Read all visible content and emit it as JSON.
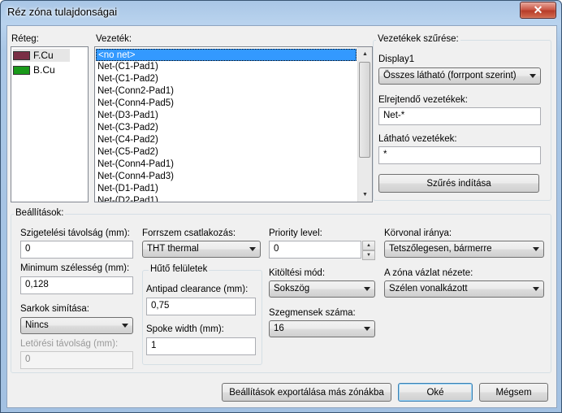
{
  "window": {
    "title": "Réz zóna tulajdonságai",
    "close_glyph": "✕"
  },
  "layers": {
    "label": "Réteg:",
    "items": [
      {
        "name": "F.Cu",
        "color": "#7a2e45"
      },
      {
        "name": "B.Cu",
        "color": "#1a9a1a"
      }
    ]
  },
  "nets": {
    "label": "Vezeték:",
    "items": [
      "<no net>",
      "Net-(C1-Pad1)",
      "Net-(C1-Pad2)",
      "Net-(Conn2-Pad1)",
      "Net-(Conn4-Pad5)",
      "Net-(D3-Pad1)",
      "Net-(C3-Pad2)",
      "Net-(C4-Pad2)",
      "Net-(C5-Pad2)",
      "Net-(Conn4-Pad1)",
      "Net-(Conn4-Pad3)",
      "Net-(D1-Pad1)",
      "Net-(D2-Pad1)"
    ],
    "selected_index": 0
  },
  "filter": {
    "label": "Vezetékek szűrése:",
    "display_label": "Display1",
    "display_value": "Összes látható (forrpont szerint)",
    "hidden_label": "Elrejtendő vezetékek:",
    "hidden_value": "Net-*",
    "visible_label": "Látható vezetékek:",
    "visible_value": "*",
    "apply_button": "Szűrés indítása"
  },
  "settings": {
    "label": "Beállítások:",
    "clearance_label": "Szigetelési távolság (mm):",
    "clearance_value": "0",
    "min_width_label": "Minimum szélesség (mm):",
    "min_width_value": "0,128",
    "corner_label": "Sarkok simítása:",
    "corner_value": "Nincs",
    "chamfer_label": "Letörési távolság (mm):",
    "chamfer_value": "0",
    "pad_conn_label": "Forrszem csatlakozás:",
    "pad_conn_value": "THT thermal",
    "thermal_group_label": "Hűtő felületek",
    "antipad_label": "Antipad clearance (mm):",
    "antipad_value": "0,75",
    "spoke_label": "Spoke width (mm):",
    "spoke_value": "1",
    "priority_label": "Priority level:",
    "priority_value": "0",
    "fill_mode_label": "Kitöltési mód:",
    "fill_mode_value": "Sokszög",
    "segments_label": "Szegmensek száma:",
    "segments_value": "16",
    "outline_dir_label": "Körvonal iránya:",
    "outline_dir_value": "Tetszőlegesen, bármerre",
    "outline_view_label": "A zóna vázlat nézete:",
    "outline_view_value": "Szélen vonalkázott"
  },
  "footer": {
    "export_button": "Beállítások exportálása más zónákba",
    "ok_button": "Oké",
    "cancel_button": "Mégsem"
  }
}
